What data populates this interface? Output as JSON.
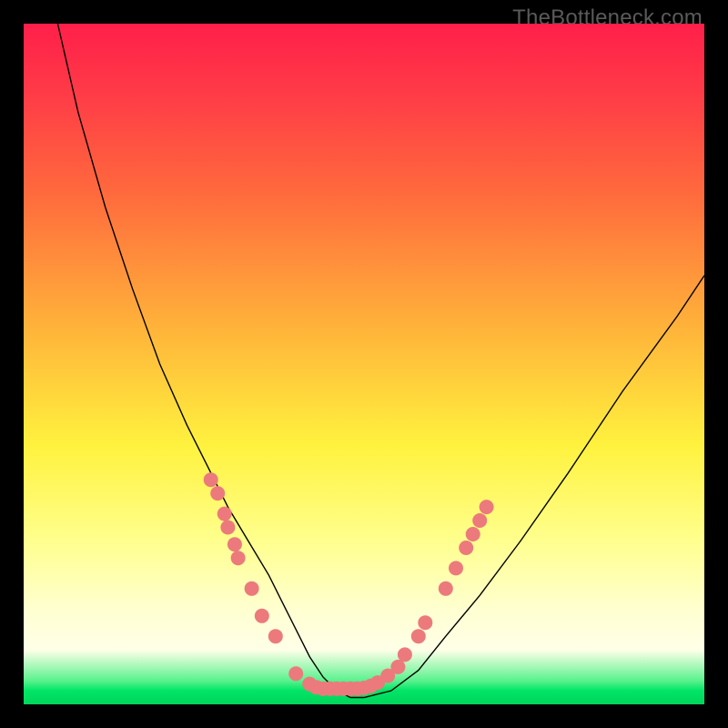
{
  "watermark": "TheBottleneck.com",
  "chart_data": {
    "type": "line",
    "title": "",
    "xlabel": "",
    "ylabel": "",
    "xlim": [
      0,
      100
    ],
    "ylim": [
      0,
      100
    ],
    "series": [
      {
        "name": "curve",
        "x": [
          5,
          8,
          12,
          16,
          20,
          24,
          27,
          30,
          33,
          36,
          38,
          40,
          42,
          44,
          46,
          48,
          50,
          54,
          58,
          62,
          67,
          73,
          80,
          88,
          96,
          100
        ],
        "y": [
          100,
          87,
          73,
          61,
          50,
          41,
          35,
          29,
          24,
          19,
          15,
          11,
          7,
          4,
          2,
          1,
          1,
          2,
          5,
          10,
          16,
          24,
          34,
          46,
          57,
          63
        ]
      }
    ],
    "markers": [
      {
        "x": 27.5,
        "y": 33
      },
      {
        "x": 28.5,
        "y": 31
      },
      {
        "x": 29.5,
        "y": 28
      },
      {
        "x": 30,
        "y": 26
      },
      {
        "x": 31,
        "y": 23.5
      },
      {
        "x": 31.5,
        "y": 21.5
      },
      {
        "x": 33.5,
        "y": 17
      },
      {
        "x": 35,
        "y": 13
      },
      {
        "x": 37,
        "y": 10
      },
      {
        "x": 40,
        "y": 4.5
      },
      {
        "x": 42,
        "y": 3
      },
      {
        "x": 43,
        "y": 2.5
      },
      {
        "x": 44,
        "y": 2.3
      },
      {
        "x": 45,
        "y": 2.3
      },
      {
        "x": 46,
        "y": 2.3
      },
      {
        "x": 47,
        "y": 2.3
      },
      {
        "x": 48,
        "y": 2.3
      },
      {
        "x": 49,
        "y": 2.3
      },
      {
        "x": 50,
        "y": 2.4
      },
      {
        "x": 51,
        "y": 2.7
      },
      {
        "x": 52,
        "y": 3.2
      },
      {
        "x": 53.5,
        "y": 4.2
      },
      {
        "x": 55,
        "y": 5.5
      },
      {
        "x": 56,
        "y": 7.3
      },
      {
        "x": 58,
        "y": 10
      },
      {
        "x": 59,
        "y": 12
      },
      {
        "x": 62,
        "y": 17
      },
      {
        "x": 63.5,
        "y": 20
      },
      {
        "x": 65,
        "y": 23
      },
      {
        "x": 66,
        "y": 25
      },
      {
        "x": 67,
        "y": 27
      },
      {
        "x": 68,
        "y": 29
      }
    ],
    "colors": {
      "curve": "#000000",
      "markers": "#ec7a7c",
      "gradient_top": "#ff1f4a",
      "gradient_bottom": "#00d65b"
    }
  }
}
